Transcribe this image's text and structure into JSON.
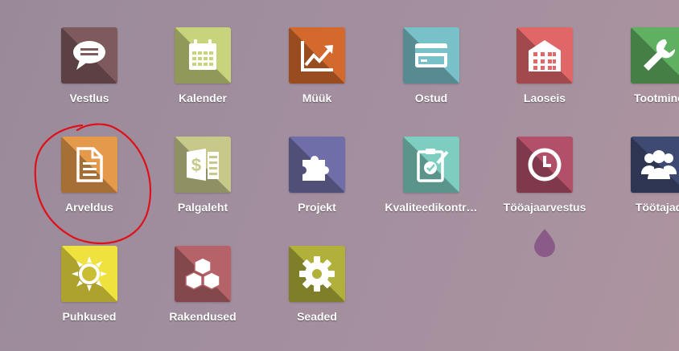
{
  "apps": [
    {
      "label": "Vestlus",
      "icon": "chat-icon",
      "color": "#7e5a5d"
    },
    {
      "label": "Kalender",
      "icon": "calendar-icon",
      "color": "#c7d47b"
    },
    {
      "label": "Müük",
      "icon": "trend-chart-icon",
      "color": "#d3692c"
    },
    {
      "label": "Ostud",
      "icon": "credit-card-icon",
      "color": "#79c1c9"
    },
    {
      "label": "Laoseis",
      "icon": "warehouse-icon",
      "color": "#e06668"
    },
    {
      "label": "Tootmine",
      "icon": "wrench-icon",
      "color": "#5fb061"
    },
    {
      "label": "Arveldus",
      "icon": "document-icon",
      "color": "#e59a4b"
    },
    {
      "label": "Palgaleht",
      "icon": "payslip-icon",
      "color": "#c6c98a"
    },
    {
      "label": "Projekt",
      "icon": "puzzle-icon",
      "color": "#6f6ea8"
    },
    {
      "label": "Kvaliteedikontr…",
      "icon": "quality-check-icon",
      "color": "#7dcdc0"
    },
    {
      "label": "Tööajaarvestus",
      "icon": "clock-icon",
      "color": "#b24f69"
    },
    {
      "label": "Töötajad",
      "icon": "people-icon",
      "color": "#3f4a73"
    },
    {
      "label": "Puhkused",
      "icon": "sun-icon",
      "color": "#efe13e"
    },
    {
      "label": "Rakendused",
      "icon": "cubes-icon",
      "color": "#b56368"
    },
    {
      "label": "Seaded",
      "icon": "gear-icon",
      "color": "#b0b03a"
    }
  ],
  "annotation": {
    "color": "#e0101a"
  }
}
